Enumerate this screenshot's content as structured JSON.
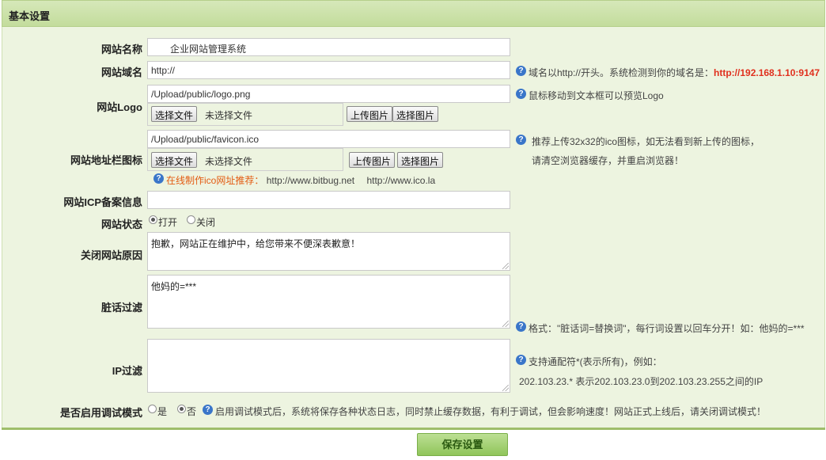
{
  "header": {
    "title": "基本设置"
  },
  "labels": {
    "site_name": "网站名称",
    "site_domain": "网站域名",
    "site_logo": "网站Logo",
    "favicon": "网站地址栏图标",
    "icp": "网站ICP备案信息",
    "status": "网站状态",
    "close_reason": "关闭网站原因",
    "bad_words": "脏话过滤",
    "ip_filter": "IP过滤",
    "debug": "是否启用调试模式"
  },
  "fields": {
    "site_name": "企业网站管理系统",
    "site_domain": "http://",
    "logo_path": "/Upload/public/logo.png",
    "favicon_path": "/Upload/public/favicon.ico",
    "icp": "",
    "close_reason": "抱歉，网站正在维护中，给您带来不便深表歉意！",
    "bad_words": "他妈的=***",
    "ip_filter": ""
  },
  "file_controls": {
    "choose": "选择文件",
    "none": "未选择文件",
    "upload": "上传图片",
    "select": "选择图片"
  },
  "tips": {
    "domain_prefix": "域名以http://开头。系统检测到你的域名是：",
    "domain_value": "http://192.168.1.10:9147",
    "logo": "鼠标移动到文本框可以预览Logo",
    "favicon_line1": "推荐上传32x32的ico图标，如无法看到新上传的图标，",
    "favicon_line2": "请清空浏览器缓存，并重启浏览器！",
    "ico_recommend": "在线制作ico网址推荐：",
    "ico_site1": "http://www.bitbug.net",
    "ico_site2": "http://www.ico.la",
    "bad_words": "格式：\"脏话词=替换词\"，每行词设置以回车分开！如：他妈的=***",
    "ip_line1": "支持通配符*(表示所有)，例如：",
    "ip_line2": "202.103.23.* 表示202.103.23.0到202.103.23.255之间的IP",
    "debug": "启用调试模式后，系统将保存各种状态日志，同时禁止缓存数据，有利于调试，但会影响速度！网站正式上线后，请关闭调试模式！"
  },
  "status_options": {
    "open": "打开",
    "closed": "关闭",
    "selected": "打开"
  },
  "debug_options": {
    "yes": "是",
    "no": "否",
    "selected": "否"
  },
  "help_icon": "?",
  "save_button": "保存设置",
  "colors": {
    "panel": "#edf4e0",
    "header": "#c9e0a6",
    "tip_red": "#e0301e",
    "save_green": "#8fc55a"
  }
}
